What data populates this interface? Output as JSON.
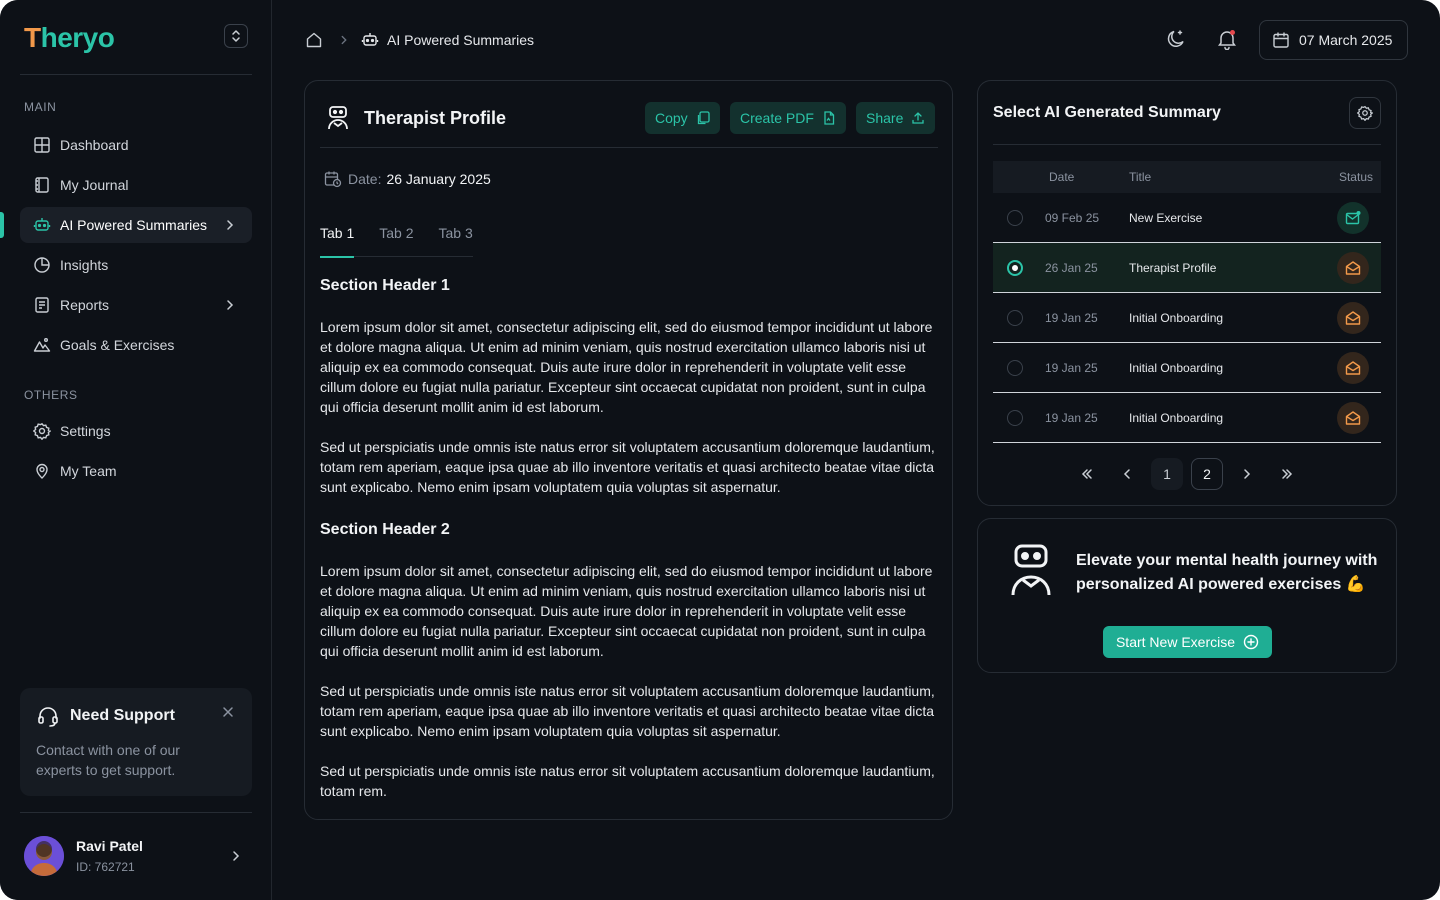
{
  "brand": {
    "logo_first": "T",
    "logo_rest": "heryo"
  },
  "sidebar": {
    "main_label": "MAIN",
    "others_label": "OTHERS",
    "items": [
      {
        "label": "Dashboard"
      },
      {
        "label": "My Journal"
      },
      {
        "label": "AI Powered Summaries"
      },
      {
        "label": "Insights"
      },
      {
        "label": "Reports"
      },
      {
        "label": "Goals & Exercises"
      },
      {
        "label": "Settings"
      },
      {
        "label": "My Team"
      }
    ],
    "support": {
      "title": "Need Support",
      "text": "Contact with one of our experts to get support."
    },
    "user": {
      "name": "Ravi Patel",
      "id": "ID: 762721"
    }
  },
  "header": {
    "breadcrumb_current": "AI Powered Summaries",
    "date": "07 March 2025"
  },
  "profile": {
    "title": "Therapist Profile",
    "copy_label": "Copy",
    "pdf_label": "Create PDF",
    "share_label": "Share",
    "date_label": "Date:",
    "date_value": "26 January 2025",
    "tabs": [
      "Tab 1",
      "Tab 2",
      "Tab 3"
    ],
    "section1": "Section Header 1",
    "section2": "Section Header 2",
    "p1": "Lorem ipsum dolor sit amet, consectetur adipiscing elit, sed do eiusmod tempor incididunt ut labore et dolore magna aliqua. Ut enim ad minim veniam, quis nostrud exercitation ullamco laboris nisi ut aliquip ex ea commodo consequat. Duis aute irure dolor in reprehenderit in voluptate velit esse cillum dolore eu fugiat nulla pariatur. Excepteur sint occaecat cupidatat non proident, sunt in culpa qui officia deserunt mollit anim id est laborum.",
    "p2": "Sed ut perspiciatis unde omnis iste natus error sit voluptatem accusantium doloremque laudantium, totam rem aperiam, eaque ipsa quae ab illo inventore veritatis et quasi architecto beatae vitae dicta sunt explicabo. Nemo enim ipsam voluptatem quia voluptas sit aspernatur.",
    "p3": "Lorem ipsum dolor sit amet, consectetur adipiscing elit, sed do eiusmod tempor incididunt ut labore et dolore magna aliqua. Ut enim ad minim veniam, quis nostrud exercitation ullamco laboris nisi ut aliquip ex ea commodo consequat. Duis aute irure dolor in reprehenderit in voluptate velit esse cillum dolore eu fugiat nulla pariatur. Excepteur sint occaecat cupidatat non proident, sunt in culpa qui officia deserunt mollit anim id est laborum.",
    "p4": "Sed ut perspiciatis unde omnis iste natus error sit voluptatem accusantium doloremque laudantium, totam rem aperiam, eaque ipsa quae ab illo inventore veritatis et quasi architecto beatae vitae dicta sunt explicabo. Nemo enim ipsam voluptatem quia voluptas sit aspernatur.",
    "p5": "Sed ut perspiciatis unde omnis iste natus error sit voluptatem accusantium doloremque laudantium, totam rem."
  },
  "summaries": {
    "title": "Select AI Generated Summary",
    "columns": {
      "date": "Date",
      "title": "Title",
      "status": "Status"
    },
    "rows": [
      {
        "date": "09 Feb 25",
        "title": "New Exercise",
        "status": "new-mail-icon",
        "selected": false
      },
      {
        "date": "26 Jan 25",
        "title": "Therapist Profile",
        "status": "opened-mail-icon",
        "selected": true
      },
      {
        "date": "19 Jan 25",
        "title": "Initial Onboarding",
        "status": "opened-mail-icon",
        "selected": false
      },
      {
        "date": "19 Jan 25",
        "title": "Initial Onboarding",
        "status": "opened-mail-icon",
        "selected": false
      },
      {
        "date": "19 Jan 25",
        "title": "Initial Onboarding",
        "status": "opened-mail-icon",
        "selected": false
      }
    ],
    "pages": [
      "1",
      "2"
    ],
    "current_page": "2"
  },
  "cta": {
    "text": "Elevate your mental health journey with personalized AI powered exercises 💪",
    "button": "Start New Exercise"
  },
  "colors": {
    "accent": "#2bc4a8",
    "background": "#0d1117",
    "warning": "#f2994a"
  }
}
